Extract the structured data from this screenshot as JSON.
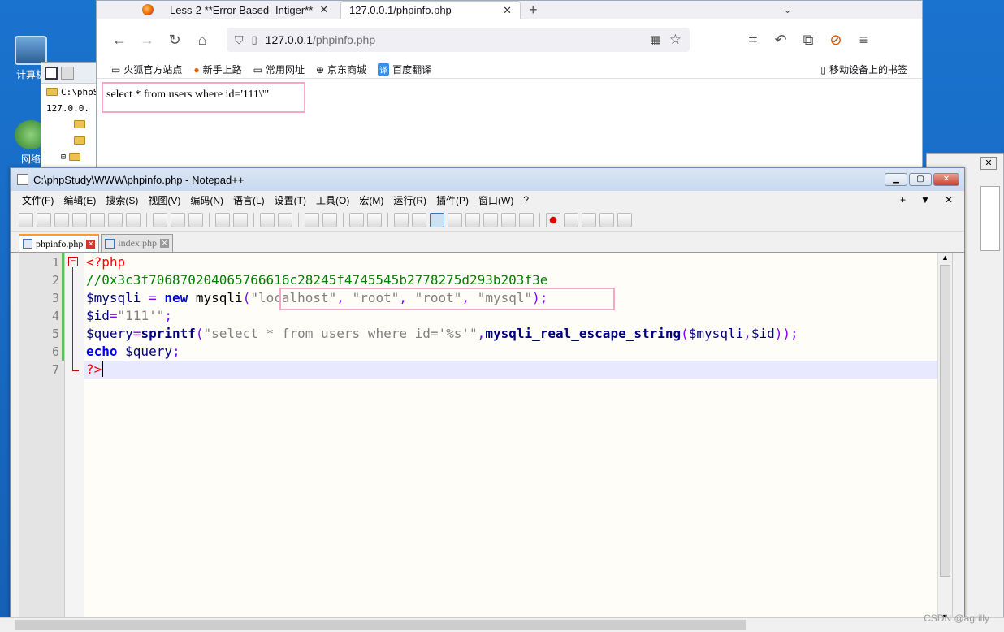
{
  "desktop": {
    "icons": [
      {
        "label": "计算机",
        "icon": "computer-icon"
      },
      {
        "label": "网络",
        "icon": "network-icon"
      }
    ]
  },
  "explorer": {
    "path": "C:\\phpS",
    "crumb": "127.0.0."
  },
  "browser": {
    "tabs": [
      {
        "label": "Less-2 **Error Based- Intiger**",
        "icon": "firefox-icon",
        "active": false
      },
      {
        "label": "127.0.0.1/phpinfo.php",
        "active": true
      }
    ],
    "url": {
      "host": "127.0.0.1",
      "path": "/phpinfo.php"
    },
    "bookmarks": [
      "火狐官方站点",
      "新手上路",
      "常用网址",
      "京东商城",
      "百度翻译"
    ],
    "mobile_bookmarks": "移动设备上的书签",
    "output": "select * from users where id='111\\\"'"
  },
  "notepad": {
    "title": "C:\\phpStudy\\WWW\\phpinfo.php - Notepad++",
    "menu": [
      "文件(F)",
      "编辑(E)",
      "搜索(S)",
      "视图(V)",
      "编码(N)",
      "语言(L)",
      "设置(T)",
      "工具(O)",
      "宏(M)",
      "运行(R)",
      "插件(P)",
      "窗口(W)",
      "?"
    ],
    "menu_right": [
      "+",
      "▼",
      "✕"
    ],
    "tabs": [
      {
        "label": "phpinfo.php",
        "active": true
      },
      {
        "label": "index.php",
        "active": false
      }
    ],
    "lines": [
      "1",
      "2",
      "3",
      "4",
      "5",
      "6",
      "7"
    ],
    "code": {
      "l1": "<?php",
      "l2": "//0x3c3f706870204065766616c28245f4745545b2778275d293b203f3e",
      "l3_var": "$mysqli",
      "l3_eq": " = ",
      "l3_new": "new",
      "l3_fn": " mysqli",
      "l3_open": "(",
      "l3_s1": "\"localhost\"",
      "l3_c1": ", ",
      "l3_s2": "\"root\"",
      "l3_c2": ", ",
      "l3_s3": "\"root\"",
      "l3_c3": ", ",
      "l3_s4": "\"mysql\"",
      "l3_close": ");",
      "l4_var": "$id",
      "l4_eq": "=",
      "l4_str": "\"111'\"",
      "l4_end": ";",
      "l5_var": "$query",
      "l5_eq": "=",
      "l5_fn": "sprintf",
      "l5_open": "(",
      "l5_str": "\"select * from users where id='%s'\"",
      "l5_comma": ",",
      "l5_fn2": "mysqli_real_escape_string",
      "l5_args_open": "(",
      "l5_arg1": "$mysqli",
      "l5_arg_comma": ",",
      "l5_arg2": "$id",
      "l5_close": "));",
      "l6_kw": "echo",
      "l6_var": " $query",
      "l6_end": ";",
      "l7": "?>"
    }
  },
  "watermark": "CSDN @agrilly"
}
